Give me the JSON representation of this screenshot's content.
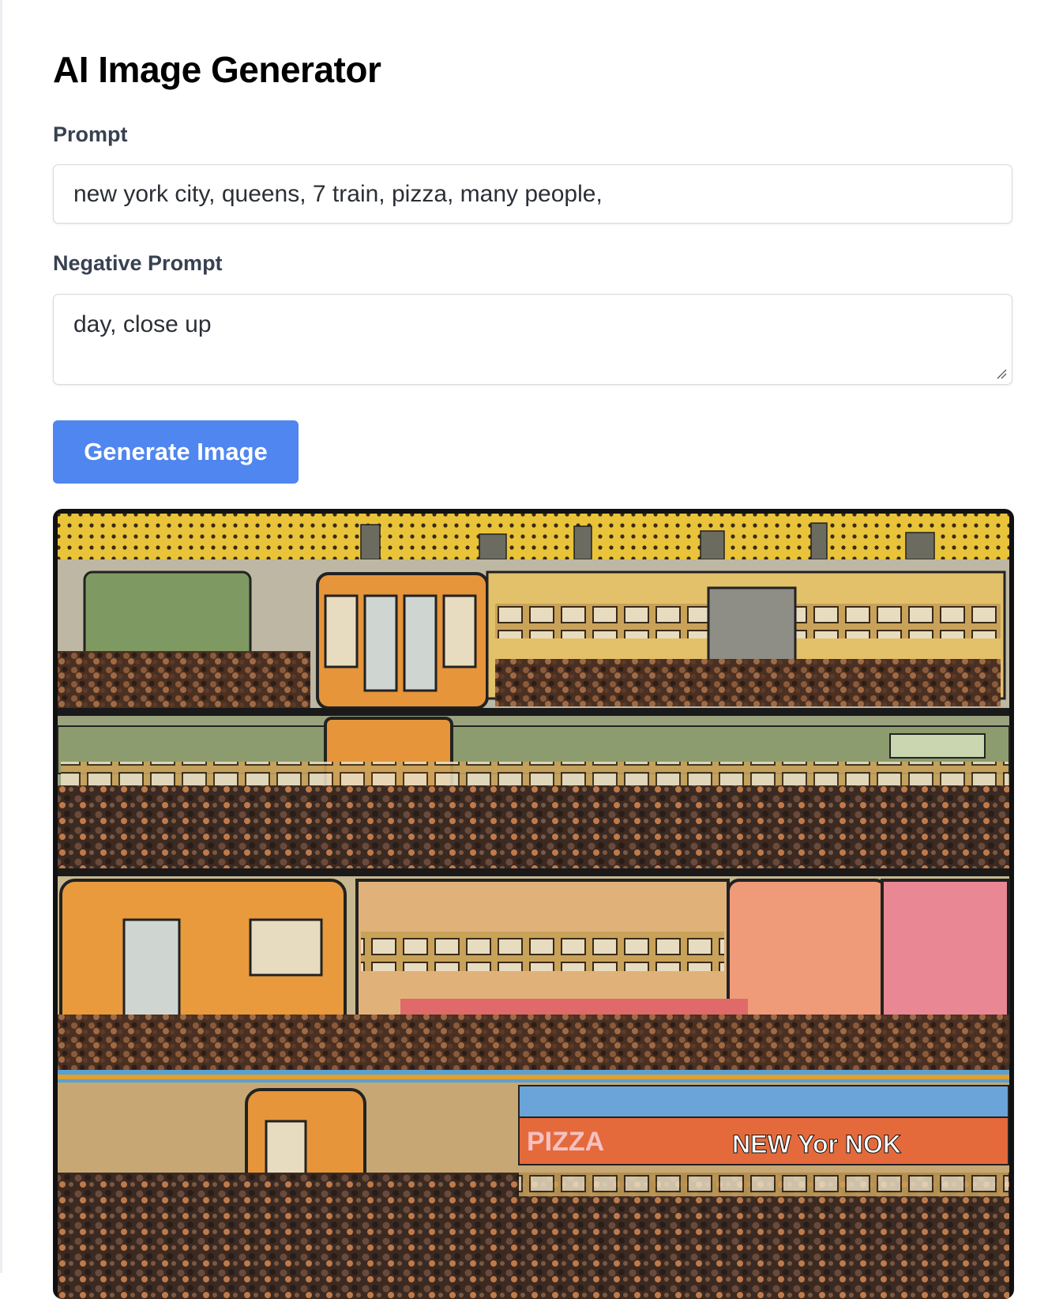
{
  "app": {
    "title": "AI Image Generator"
  },
  "form": {
    "prompt_label": "Prompt",
    "prompt_value": "new york city, queens, 7 train, pizza, many people,",
    "negative_label": "Negative Prompt",
    "negative_value": "day, close up",
    "generate_label": "Generate Image"
  },
  "image": {
    "sign_text": "NEW Yor NOK",
    "pizza_text": "PIZZA"
  },
  "colors": {
    "button": "#4f86f0",
    "label": "#374151"
  }
}
